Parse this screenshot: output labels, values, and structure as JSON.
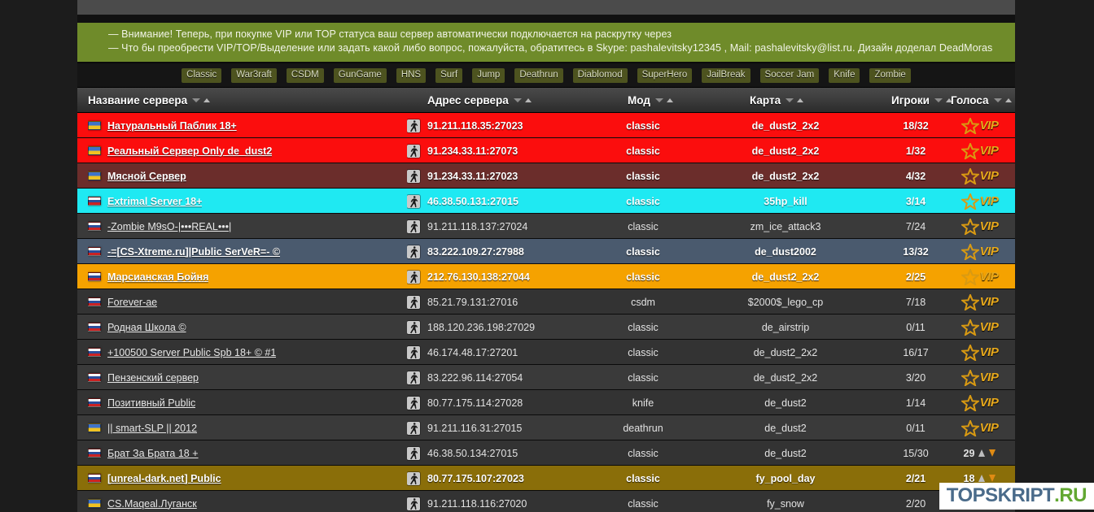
{
  "banner": {
    "line1": "— Внимание! Теперь, при покупке VIP или TOP статуса ваш сервер автоматически подключается на раскрутку через",
    "line2": "— Что бы преобрести VIP/TOP/Выделение или задать какой либо вопрос, пожалуйста, обратитесь в Skype: pashalevitsky12345 , Mail: pashalevitsky@list.ru. Дизайн доделал DeadMoras"
  },
  "mod_filters": [
    "Classic",
    "War3raft",
    "CSDM",
    "GunGame",
    "HNS",
    "Surf",
    "Jump",
    "Deathrun",
    "Diablomod",
    "SuperHero",
    "JailBreak",
    "Soccer Jam",
    "Knife",
    "Zombie"
  ],
  "columns": [
    {
      "label": "Название сервера"
    },
    {
      "label": "Адрес сервера"
    },
    {
      "label": "Мод"
    },
    {
      "label": "Карта"
    },
    {
      "label": "Игроки"
    },
    {
      "label": "Голоса"
    }
  ],
  "colors": {
    "banner_green": "#6f8b2a",
    "mod_button": "#4d531f",
    "row_default": "#3a3a3a",
    "highlight_red": "#fb0d0d",
    "highlight_maroon": "#6b2d2b",
    "highlight_cyan": "#1fe9f2",
    "highlight_slate": "#4a5a6e",
    "highlight_orange": "#f5a200",
    "highlight_olive": "#8a6e09",
    "vip_gold": "#e8a91c",
    "vote_down_arrow": "#e08b13"
  },
  "rows": [
    {
      "flag": "ua",
      "name": "Натуральный Паблик 18+",
      "addr": "91.211.118.35:27023",
      "mod": "classic",
      "map": "de_dust2_2x2",
      "players": "18/32",
      "vip": true,
      "votes": null,
      "hl": "hl-red"
    },
    {
      "flag": "ua",
      "name": "Реальный Сервер Only de_dust2",
      "addr": "91.234.33.11:27073",
      "mod": "classic",
      "map": "de_dust2_2x2",
      "players": "1/32",
      "vip": true,
      "votes": null,
      "hl": "hl-red"
    },
    {
      "flag": "ua",
      "name": "Мясной Сервер",
      "addr": "91.234.33.11:27023",
      "mod": "classic",
      "map": "de_dust2_2x2",
      "players": "4/32",
      "vip": true,
      "votes": null,
      "hl": "hl-maroon"
    },
    {
      "flag": "ru",
      "name": "Extrimal Server 18+",
      "addr": "46.38.50.131:27015",
      "mod": "classic",
      "map": "35hp_kill",
      "players": "3/14",
      "vip": true,
      "votes": null,
      "hl": "hl-cyan"
    },
    {
      "flag": "ru",
      "name": "-Zombie M9sO-|•••REAL•••|",
      "addr": "91.211.118.137:27024",
      "mod": "classic",
      "map": "zm_ice_attack3",
      "players": "7/24",
      "vip": true,
      "votes": null,
      "hl": ""
    },
    {
      "flag": "ru",
      "name": "-=[CS-Xtreme.ru]|Public SerVeR=- ©",
      "addr": "83.222.109.27:27988",
      "mod": "classic",
      "map": "de_dust2002",
      "players": "13/32",
      "vip": true,
      "votes": null,
      "hl": "hl-slate"
    },
    {
      "flag": "ru",
      "name": "Марсианская Бойня",
      "addr": "212.76.130.138:27044",
      "mod": "classic",
      "map": "de_dust2_2x2",
      "players": "2/25",
      "vip": true,
      "votes": null,
      "hl": "hl-orange"
    },
    {
      "flag": "ru",
      "name": "Forever-ae",
      "addr": "85.21.79.131:27016",
      "mod": "csdm",
      "map": "$2000$_lego_cp",
      "players": "7/18",
      "vip": true,
      "votes": null,
      "hl": ""
    },
    {
      "flag": "ru",
      "name": "Родная Школа ©",
      "addr": "188.120.236.198:27029",
      "mod": "classic",
      "map": "de_airstrip",
      "players": "0/11",
      "vip": true,
      "votes": null,
      "hl": ""
    },
    {
      "flag": "ru",
      "name": "+100500 Server Public Spb 18+ © #1",
      "addr": "46.174.48.17:27201",
      "mod": "classic",
      "map": "de_dust2_2x2",
      "players": "16/17",
      "vip": true,
      "votes": null,
      "hl": ""
    },
    {
      "flag": "ru",
      "name": "Пензенский сервер",
      "addr": "83.222.96.114:27054",
      "mod": "classic",
      "map": "de_dust2_2x2",
      "players": "3/20",
      "vip": true,
      "votes": null,
      "hl": ""
    },
    {
      "flag": "ru",
      "name": "Позитивный Public",
      "addr": "80.77.175.114:27028",
      "mod": "knife",
      "map": "de_dust2",
      "players": "1/14",
      "vip": true,
      "votes": null,
      "hl": ""
    },
    {
      "flag": "ua",
      "name": "|| smart-SLP || 2012",
      "addr": "91.211.116.31:27015",
      "mod": "deathrun",
      "map": "de_dust2",
      "players": "0/11",
      "vip": true,
      "votes": null,
      "hl": ""
    },
    {
      "flag": "ru",
      "name": "Брат За Брата 18 +",
      "addr": "46.38.50.134:27015",
      "mod": "classic",
      "map": "de_dust2",
      "players": "15/30",
      "vip": false,
      "votes": "29",
      "hl": ""
    },
    {
      "flag": "ru",
      "name": "[unreal-dark.net] Public",
      "addr": "80.77.175.107:27023",
      "mod": "classic",
      "map": "fy_pool_day",
      "players": "2/21",
      "vip": false,
      "votes": "18",
      "hl": "hl-olive"
    },
    {
      "flag": "ua",
      "name": "CS.Мaqeal.Луганск",
      "addr": "91.211.118.116:27020",
      "mod": "classic",
      "map": "fy_snow",
      "players": "2/20",
      "vip": false,
      "votes": "",
      "hl": ""
    }
  ],
  "watermark": {
    "part1": "TOPSKRIPT",
    "part2": ".RU"
  },
  "icons": {
    "cs_player": "cs-player-icon",
    "sort_desc": "sort-desc-icon",
    "sort_asc": "sort-asc-icon",
    "vip_star": "vip-star-icon",
    "vote_up": "vote-up-arrow-icon",
    "vote_down": "vote-down-arrow-icon"
  },
  "vip_label": "VIP"
}
